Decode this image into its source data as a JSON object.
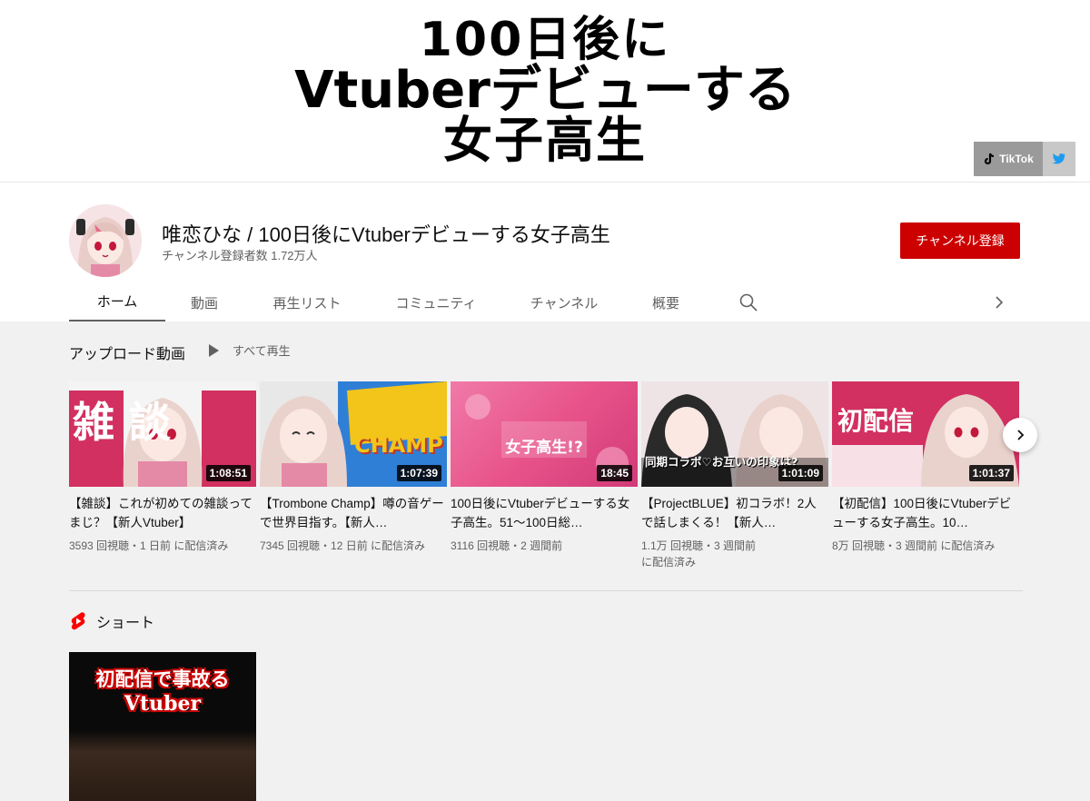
{
  "banner": {
    "line1": "100日後に",
    "line2": "Vtuberデビューする",
    "line3": "女子高生",
    "links": {
      "tiktok": "TikTok"
    }
  },
  "channel": {
    "name": "唯恋ひな / 100日後にVtuberデビューする女子高生",
    "subscribers": "チャンネル登録者数 1.72万人",
    "subscribe_label": "チャンネル登録"
  },
  "tabs": [
    {
      "label": "ホーム",
      "active": true
    },
    {
      "label": "動画"
    },
    {
      "label": "再生リスト"
    },
    {
      "label": "コミュニティ"
    },
    {
      "label": "チャンネル"
    },
    {
      "label": "概要"
    }
  ],
  "uploads": {
    "title": "アップロード動画",
    "play_all": "すべて再生",
    "videos": [
      {
        "title": "【雑談】これが初めての雑談ってまじ？【新人Vtuber】",
        "duration": "1:08:51",
        "meta": "3593 回視聴・1 日前 に配信済み",
        "thumb_text": "雑 談"
      },
      {
        "title": "【Trombone Champ】噂の音ゲーで世界目指す。【新人…",
        "duration": "1:07:39",
        "meta": "7345 回視聴・12 日前 に配信済み",
        "thumb_text": "CHAMP"
      },
      {
        "title": "100日後にVtuberデビューする女子高生。51～100日総…",
        "duration": "18:45",
        "meta": "3116 回視聴・2 週間前",
        "thumb_text": "女子高生!?"
      },
      {
        "title": "【ProjectBLUE】初コラボ！2人で話しまくる！【新人…",
        "duration": "1:01:09",
        "meta": "1.1万 回視聴・3 週間前 に配信済み",
        "thumb_text": "同期コラボ♡お互いの印象は?"
      },
      {
        "title": "【初配信】100日後にVtuberデビューする女子高生。10…",
        "duration": "1:01:37",
        "meta": "8万 回視聴・3 週間前 に配信済み",
        "thumb_text": "初配信"
      }
    ]
  },
  "shorts": {
    "title": "ショート",
    "items": [
      {
        "overlay_line1": "初配信で事故る",
        "overlay_line2": "Vtuber"
      }
    ]
  },
  "colors": {
    "subscribe_red": "#cc0000",
    "page_bg": "#f1f1f1",
    "thumb_pink": "#e8548a"
  }
}
